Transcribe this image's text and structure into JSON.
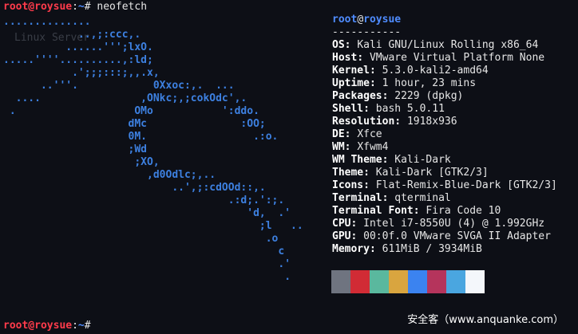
{
  "prompt_top": {
    "user_host": "root@roysue",
    "sep": ":",
    "path": "~",
    "symbol": "#",
    "command": "neofetch"
  },
  "prompt_bottom": {
    "user_host": "root@roysue",
    "sep": ":",
    "path": "~",
    "symbol": "#"
  },
  "faint_text": "Linux Server",
  "logo_lines": [
    "..............",
    "            ..,;:ccc,.",
    "          ......''';lxO.",
    ".....''''..........,:ld;",
    "           .';;;:::;,,.x,",
    "      ..'''.            0Xxoc:,.  ...",
    "  ....                ,ONkc;,;cokOdc',.",
    " .                   OMo           ':ddo.",
    "                    dMc               :OO;",
    "                    0M.                 .:o.",
    "                    ;Wd",
    "                     ;XO,",
    "                       ,d0Odlc;,..",
    "                           ..',;:cdOOd::,.",
    "                                    .:d;.':;.",
    "                                       'd,  .'",
    "                                         ;l   ..",
    "                                          .o",
    "                                            c",
    "                                            .'",
    "                                             ."
  ],
  "info": {
    "user": "root",
    "at": "@",
    "host": "roysue",
    "underline": "-----------",
    "rows": [
      {
        "key": "OS",
        "value": "Kali GNU/Linux Rolling x86_64"
      },
      {
        "key": "Host",
        "value": "VMware Virtual Platform None"
      },
      {
        "key": "Kernel",
        "value": "5.3.0-kali2-amd64"
      },
      {
        "key": "Uptime",
        "value": "1 hour, 23 mins"
      },
      {
        "key": "Packages",
        "value": "2229 (dpkg)"
      },
      {
        "key": "Shell",
        "value": "bash 5.0.11"
      },
      {
        "key": "Resolution",
        "value": "1918x936"
      },
      {
        "key": "DE",
        "value": "Xfce"
      },
      {
        "key": "WM",
        "value": "Xfwm4"
      },
      {
        "key": "WM Theme",
        "value": "Kali-Dark"
      },
      {
        "key": "Theme",
        "value": "Kali-Dark [GTK2/3]"
      },
      {
        "key": "Icons",
        "value": "Flat-Remix-Blue-Dark [GTK2/3]"
      },
      {
        "key": "Terminal",
        "value": "qterminal"
      },
      {
        "key": "Terminal Font",
        "value": "Fira Code 10"
      },
      {
        "key": "CPU",
        "value": "Intel i7-8550U (4) @ 1.992GHz"
      },
      {
        "key": "GPU",
        "value": "00:0f.0 VMware SVGA II Adapter"
      },
      {
        "key": "Memory",
        "value": "611MiB / 3934MiB"
      }
    ],
    "palette": [
      "#6f7480",
      "#d12b35",
      "#5ab89e",
      "#d9a53f",
      "#3b83f0",
      "#b5345c",
      "#4aa6e0",
      "#f4f7fb"
    ]
  },
  "watermark": "安全客（www.anquanke.com）"
}
